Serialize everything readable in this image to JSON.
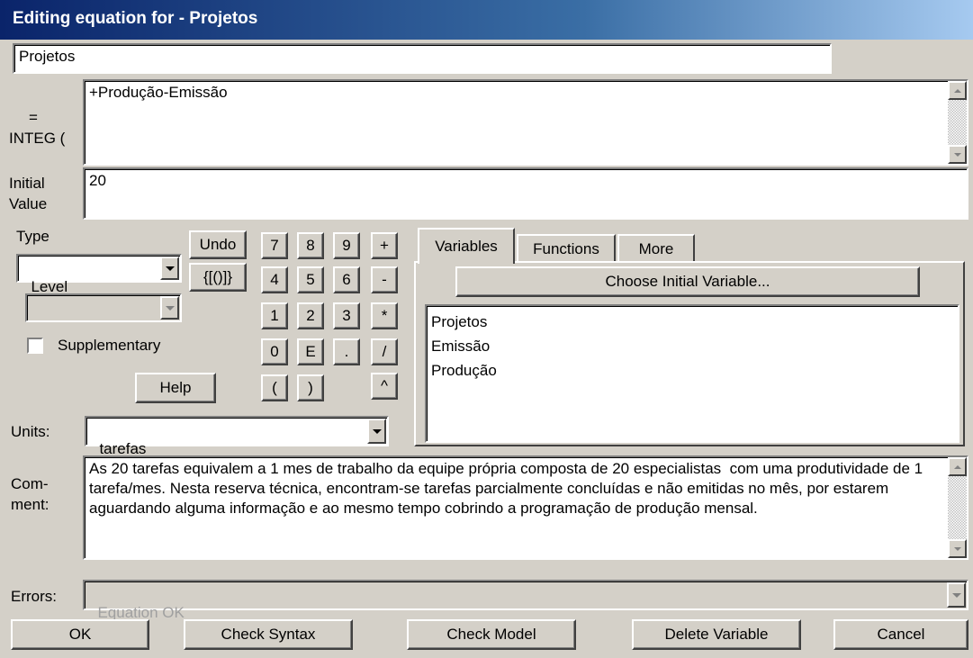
{
  "window": {
    "title": "Editing equation for - Projetos"
  },
  "variable_name": "Projetos",
  "equation": {
    "label_eq": "=",
    "label_integ": "INTEG (",
    "value": "+Produção-Emissão"
  },
  "initial_value": {
    "label_line1": "Initial",
    "label_line2": "Value",
    "value": "20"
  },
  "type": {
    "label": "Type",
    "selected": "Level",
    "sub_selected": "",
    "supplementary_label": "Supplementary",
    "supplementary_checked": false
  },
  "keypad": {
    "undo": "Undo",
    "brackets": "{[()]}",
    "help": "Help",
    "keys": [
      "7",
      "8",
      "9",
      "+",
      "4",
      "5",
      "6",
      "-",
      "1",
      "2",
      "3",
      "*",
      "0",
      "E",
      ".",
      "/",
      "(",
      ")",
      "^"
    ]
  },
  "tabs": [
    "Variables",
    "Functions",
    "More"
  ],
  "choose_initial_variable": "Choose Initial Variable...",
  "variables_list": [
    "Projetos",
    "Emissão",
    "Produção"
  ],
  "units": {
    "label": "Units:",
    "value": "tarefas"
  },
  "comment": {
    "label_line1": "Com-",
    "label_line2": "ment:",
    "value": "As 20 tarefas equivalem a 1 mes de trabalho da equipe própria composta de 20 especialistas  com uma produtividade de 1 tarefa/mes. Nesta reserva técnica, encontram-se tarefas parcialmente concluídas e não emitidas no mês, por estarem aguardando alguma informação e ao mesmo tempo cobrindo a programação de produção mensal."
  },
  "errors": {
    "label": "Errors:",
    "value": "Equation OK"
  },
  "buttons": {
    "ok": "OK",
    "check_syntax": "Check Syntax",
    "check_model": "Check Model",
    "delete_variable": "Delete Variable",
    "cancel": "Cancel"
  },
  "colors": {
    "title_bar_start": "#0a246a",
    "title_bar_end": "#a6caf0",
    "face": "#d4d0c8"
  }
}
